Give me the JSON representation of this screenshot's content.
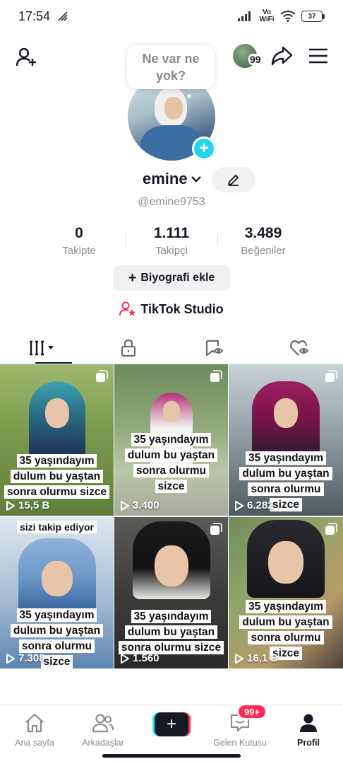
{
  "status_bar": {
    "time": "17:54",
    "network": "Vo WiFi",
    "battery": "37"
  },
  "header": {
    "story_count": "99"
  },
  "note_bubble": "Ne var ne yok?",
  "profile": {
    "username": "emine",
    "handle": "@emine9753"
  },
  "stats": [
    {
      "value": "0",
      "label": "Takipte"
    },
    {
      "value": "1.111",
      "label": "Takipçi"
    },
    {
      "value": "3.489",
      "label": "Beğeniler"
    }
  ],
  "bio_button": "Biyografi ekle",
  "studio_link": "TikTok Studio",
  "videos": [
    {
      "caption": [
        "35 yaşındayım",
        "dulum bu yaştan",
        "sonra olurmu sizce"
      ],
      "views": "15,5 B",
      "top_caption": ""
    },
    {
      "caption": [
        "35 yaşındayım",
        "dulum bu yaştan",
        "sonra olurmu",
        "sizce"
      ],
      "views": "3.400",
      "top_caption": ""
    },
    {
      "caption": [
        "35 yaşındayım",
        "dulum bu yaştan",
        "sonra olurmu",
        "sizce"
      ],
      "views": "6.282",
      "top_caption": ""
    },
    {
      "caption": [
        "35 yaşındayım",
        "dulum bu yaştan",
        "sonra olurmu",
        "sizce"
      ],
      "views": "7.308",
      "top_caption": "sizi takip ediyor"
    },
    {
      "caption": [
        "35 yaşındayım",
        "dulum bu yaştan",
        "sonra olurmu sizce"
      ],
      "views": "1.560",
      "top_caption": ""
    },
    {
      "caption": [
        "35 yaşındayım",
        "dulum bu yaştan",
        "sonra olurmu",
        "sizce"
      ],
      "views": "16,1 B",
      "top_caption": ""
    }
  ],
  "bottom_nav": {
    "home": "Ana sayfa",
    "friends": "Arkadaşlar",
    "inbox": "Gelen Kutusu",
    "inbox_badge": "99+",
    "profile": "Profil"
  },
  "colors": {
    "accent": "#fe2c55",
    "cyan": "#25f4ee",
    "avatar_plus": "#20d5ec",
    "text": "#161823",
    "muted": "#8a8b91"
  }
}
